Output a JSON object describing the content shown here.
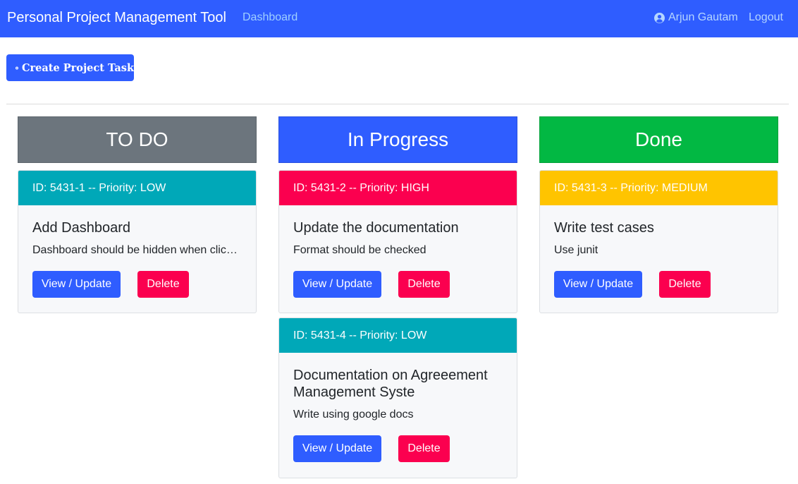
{
  "navbar": {
    "brand": "Personal Project Management Tool",
    "dashboard_link": "Dashboard",
    "user_name": "Arjun Gautam",
    "user_icon": "user-circle-icon",
    "logout_link": "Logout"
  },
  "create_button": {
    "label": "Create Project Task",
    "icon": "plus-circle-icon"
  },
  "colors": {
    "primary": "#2f5dff",
    "todo": "#6c757d",
    "in_progress": "#2f5dff",
    "done": "#02b843",
    "priority_low": "#00a8b8",
    "priority_high": "#fb004f",
    "priority_medium": "#ffc400",
    "danger": "#fb004f"
  },
  "columns": [
    {
      "title": "TO DO",
      "tasks": [
        {
          "header": "ID: 5431-1 -- Priority: LOW",
          "title": "Add Dashboard",
          "description": "Dashboard should be hidden when clicked",
          "view_label": "View / Update",
          "delete_label": "Delete"
        }
      ]
    },
    {
      "title": "In Progress",
      "tasks": [
        {
          "header": "ID: 5431-2 -- Priority: HIGH",
          "title": "Update the documentation",
          "description": "Format should be checked",
          "view_label": "View / Update",
          "delete_label": "Delete"
        },
        {
          "header": "ID: 5431-4 -- Priority: LOW",
          "title": "Documentation on Agreeement Management Syste",
          "description": "Write using google docs",
          "view_label": "View / Update",
          "delete_label": "Delete"
        }
      ]
    },
    {
      "title": "Done",
      "tasks": [
        {
          "header": "ID: 5431-3 -- Priority: MEDIUM",
          "title": "Write test cases",
          "description": "Use junit",
          "view_label": "View / Update",
          "delete_label": "Delete"
        }
      ]
    }
  ]
}
